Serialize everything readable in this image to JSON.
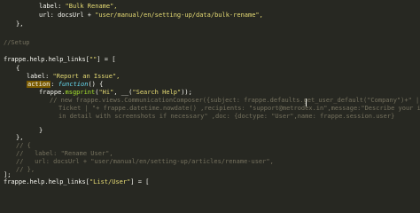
{
  "code": {
    "l1_label_key": "label: ",
    "l1_label_val": "\"Bulk Rename\",",
    "l2_url_key": "url: docsUrl + ",
    "l2_url_val": "\"user/manual/en/setting-up/data/bulk-rename\",",
    "l3_close": "},",
    "l4_comment": "//Setup",
    "l5_a": "frappe.help.help_links[",
    "l5_b": "\"\"",
    "l5_c": "] = [",
    "l6_open": "{",
    "l7_label_key": "label: ",
    "l7_label_val": "\"Report an Issue\",",
    "l8_action": "action",
    "l8_rest_a": ": ",
    "l8_function": "function",
    "l8_rest_b": "() {",
    "l9_a": "frappe.",
    "l9_fn": "msgprint",
    "l9_b": "(",
    "l9_s1": "\"Hi\"",
    "l9_c": ", __(",
    "l9_s2": "\"Search Help\"",
    "l9_d": "));",
    "l10_comment": "// new frappe.views.CommunicationComposer({subject: frappe.defaults.get_user_default(\"Company\")+\" | Support",
    "l11_comment_a": "Ticket | \"+ frappe.datetime.nowdate() ,recipients: \"support@metrodex.in",
    "l11_comment_b": "\",message:\"Describe your issue or request",
    "l12_comment": "in detail with screenshots if necessary\" ,doc: {doctype: \"User\",name: frappe.session.user}",
    "l13_close": "}",
    "l14_close": "},",
    "l15_comment": "// {",
    "l16_comment": "//   label: \"Rename User\",",
    "l17_comment": "//   url: docsUrl + \"user/manual/en/setting-up/articles/rename-user\",",
    "l18_comment": "// },",
    "l19_close": "];",
    "l20_a": "frappe.help.help_links[",
    "l20_b": "\"List/User\"",
    "l20_c": "] = ["
  }
}
